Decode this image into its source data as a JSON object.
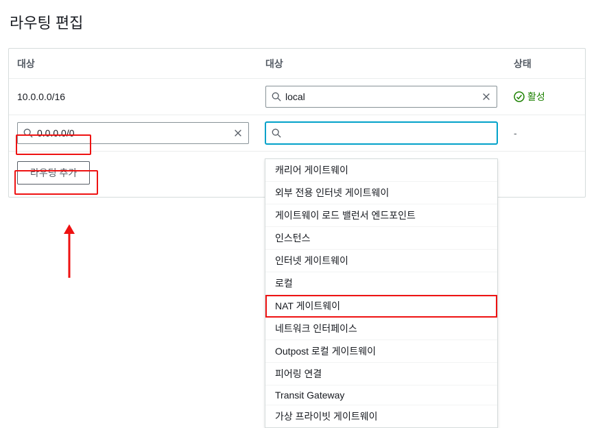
{
  "page_title": "라우팅 편집",
  "columns": {
    "destination": "대상",
    "target": "대상",
    "state": "상태"
  },
  "rows": {
    "r1": {
      "destination_text": "10.0.0.0/16",
      "target_value": "local",
      "state_label": "활성"
    },
    "r2": {
      "destination_value": "0.0.0.0/0",
      "target_value": "",
      "state_text": "-"
    }
  },
  "buttons": {
    "add_route": "라우팅 추가"
  },
  "dropdown": {
    "items": [
      "캐리어 게이트웨이",
      "외부 전용 인터넷 게이트웨이",
      "게이트웨이 로드 밸런서 엔드포인트",
      "인스턴스",
      "인터넷 게이트웨이",
      "로컬",
      "NAT 게이트웨이",
      "네트워크 인터페이스",
      "Outpost 로컬 게이트웨이",
      "피어링 연결",
      "Transit Gateway",
      "가상 프라이빗 게이트웨이"
    ],
    "highlighted_index": 6
  }
}
